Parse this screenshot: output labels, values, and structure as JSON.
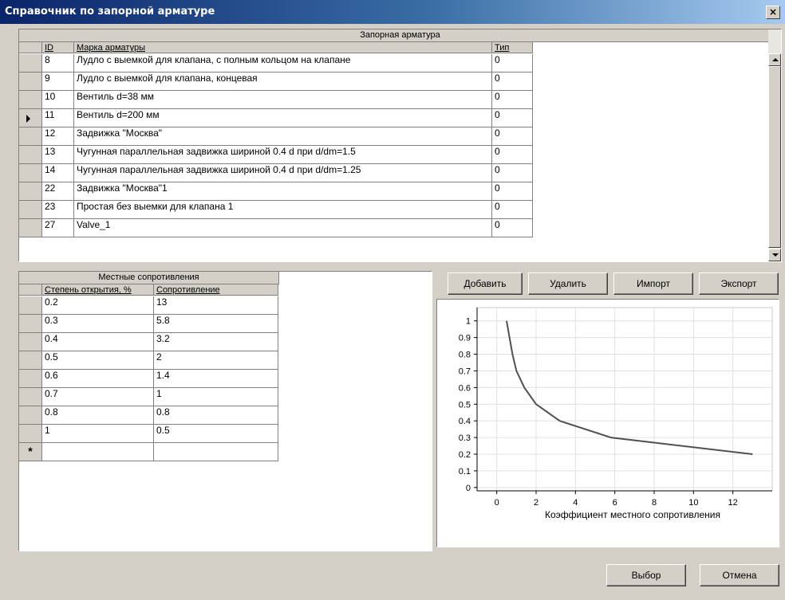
{
  "window": {
    "title": "Справочник по запорной арматуре",
    "close_glyph": "×"
  },
  "valves": {
    "caption": "Запорная арматура",
    "columns": [
      "ID",
      "Марка арматуры",
      "Тип"
    ],
    "rows": [
      {
        "id": "8",
        "name": "Лудло с выемкой для клапана, с полным кольцом на клапане",
        "type": "0"
      },
      {
        "id": "9",
        "name": "Лудло с выемкой для клапана, концевая",
        "type": "0"
      },
      {
        "id": "10",
        "name": "Вентиль d=38 мм",
        "type": "0"
      },
      {
        "id": "11",
        "name": "Вентиль d=200 мм",
        "type": "0"
      },
      {
        "id": "12",
        "name": "Задвижка \"Москва\"",
        "type": "0"
      },
      {
        "id": "13",
        "name": "Чугунная параллельная задвижка шириной 0.4 d при d/dm=1.5",
        "type": "0"
      },
      {
        "id": "14",
        "name": "Чугунная параллельная задвижка шириной 0.4 d при d/dm=1.25",
        "type": "0"
      },
      {
        "id": "22",
        "name": "Задвижка \"Москва\"1",
        "type": "0"
      },
      {
        "id": "23",
        "name": "Простая без выемки для клапана 1",
        "type": "0"
      },
      {
        "id": "27",
        "name": "Valve_1",
        "type": "0"
      }
    ],
    "selected_index": 3
  },
  "resist": {
    "caption": "Местные сопротивления",
    "columns": [
      "Степень открытия, %",
      "Сопротивление"
    ],
    "rows": [
      {
        "open": "0.2",
        "res": "13"
      },
      {
        "open": "0.3",
        "res": "5.8"
      },
      {
        "open": "0.4",
        "res": "3.2"
      },
      {
        "open": "0.5",
        "res": "2"
      },
      {
        "open": "0.6",
        "res": "1.4"
      },
      {
        "open": "0.7",
        "res": "1"
      },
      {
        "open": "0.8",
        "res": "0.8"
      },
      {
        "open": "1",
        "res": "0.5"
      }
    ],
    "new_row_glyph": "*"
  },
  "actions": {
    "add": "Добавить",
    "delete": "Удалить",
    "import": "Импорт",
    "export": "Экспорт"
  },
  "dialog": {
    "select": "Выбор",
    "cancel": "Отмена"
  },
  "chart_data": {
    "type": "line",
    "xlabel": "Коэффициент местного сопротивления",
    "ylabel": "",
    "xlim": [
      -1,
      14
    ],
    "ylim": [
      -0.02,
      1.08
    ],
    "xticks": [
      0,
      2,
      4,
      6,
      8,
      10,
      12
    ],
    "yticks": [
      0,
      0.1,
      0.2,
      0.3,
      0.4,
      0.5,
      0.6,
      0.7,
      0.8,
      0.9,
      1
    ],
    "grid": true,
    "series": [
      {
        "x": [
          13,
          5.8,
          3.2,
          2,
          1.4,
          1,
          0.8,
          0.5
        ],
        "y": [
          0.2,
          0.3,
          0.4,
          0.5,
          0.6,
          0.7,
          0.8,
          1
        ]
      }
    ],
    "line_color": "#505050"
  }
}
